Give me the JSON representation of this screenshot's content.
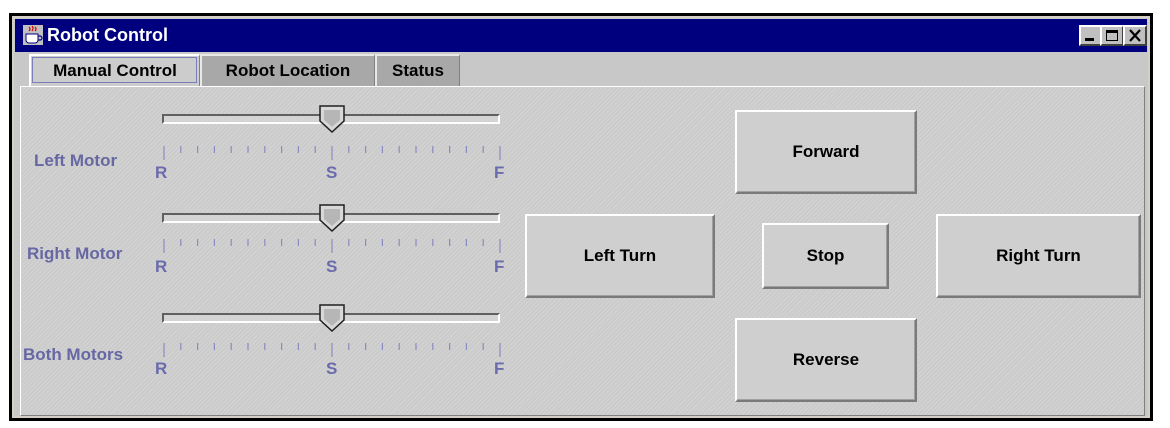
{
  "window": {
    "title": "Robot Control"
  },
  "tabs": [
    {
      "label": "Manual Control",
      "active": true
    },
    {
      "label": "Robot Location",
      "active": false
    },
    {
      "label": "Status",
      "active": false
    }
  ],
  "sliders": [
    {
      "label": "Left Motor",
      "tick_left": "R",
      "tick_center": "S",
      "tick_right": "F",
      "value": 0.5
    },
    {
      "label": "Right Motor",
      "tick_left": "R",
      "tick_center": "S",
      "tick_right": "F",
      "value": 0.5
    },
    {
      "label": "Both Motors",
      "tick_left": "R",
      "tick_center": "S",
      "tick_right": "F",
      "value": 0.5
    }
  ],
  "buttons": {
    "forward": "Forward",
    "left_turn": "Left Turn",
    "stop": "Stop",
    "right_turn": "Right Turn",
    "reverse": "Reverse"
  },
  "icons": {
    "app": "java-cup-icon",
    "minimize": "minimize-icon",
    "maximize": "maximize-icon",
    "close": "close-icon"
  },
  "colors": {
    "titlebar": "#00007f",
    "label_text": "#6667a3",
    "panel": "#cbcbcb"
  }
}
